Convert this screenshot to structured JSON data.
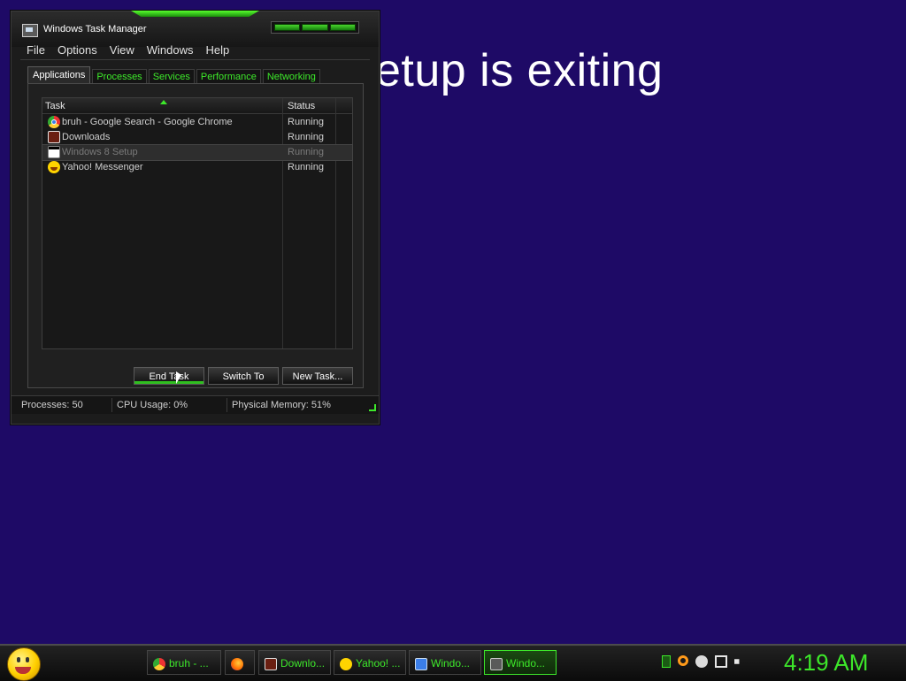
{
  "background": {
    "color": "#1e0a66",
    "setup_message": "etup is exiting"
  },
  "task_manager": {
    "title": "Windows Task Manager",
    "menu": [
      "File",
      "Options",
      "View",
      "Windows",
      "Help"
    ],
    "tabs": [
      "Applications",
      "Processes",
      "Services",
      "Performance",
      "Networking"
    ],
    "active_tab": "Applications",
    "columns": {
      "task": "Task",
      "status": "Status"
    },
    "rows": [
      {
        "task": "bruh - Google Search - Google Chrome",
        "status": "Running",
        "icon": "chrome-icon"
      },
      {
        "task": "Downloads",
        "status": "Running",
        "icon": "downloads-icon"
      },
      {
        "task": "Windows 8 Setup",
        "status": "Running",
        "icon": "setup-icon",
        "selected": true
      },
      {
        "task": "Yahoo! Messenger",
        "status": "Running",
        "icon": "yahoo-messenger-icon"
      }
    ],
    "buttons": {
      "end_task": "End Task",
      "switch_to": "Switch To",
      "new_task": "New Task..."
    },
    "status_bar": {
      "processes": "Processes: 50",
      "cpu_usage": "CPU Usage: 0%",
      "physical_memory": "Physical Memory: 51%"
    }
  },
  "taskbar": {
    "items": [
      {
        "label": "bruh - ...",
        "icon": "chrome-icon"
      },
      {
        "label": "",
        "icon": "firefox-icon"
      },
      {
        "label": "Downlo...",
        "icon": "downloads-icon"
      },
      {
        "label": "Yahoo! ...",
        "icon": "yahoo-messenger-icon"
      },
      {
        "label": "Windo...",
        "icon": "setup-icon"
      },
      {
        "label": "Windo...",
        "icon": "task-manager-icon",
        "active": true
      }
    ],
    "clock": "4:19 AM",
    "accent_color": "#3de82a"
  }
}
